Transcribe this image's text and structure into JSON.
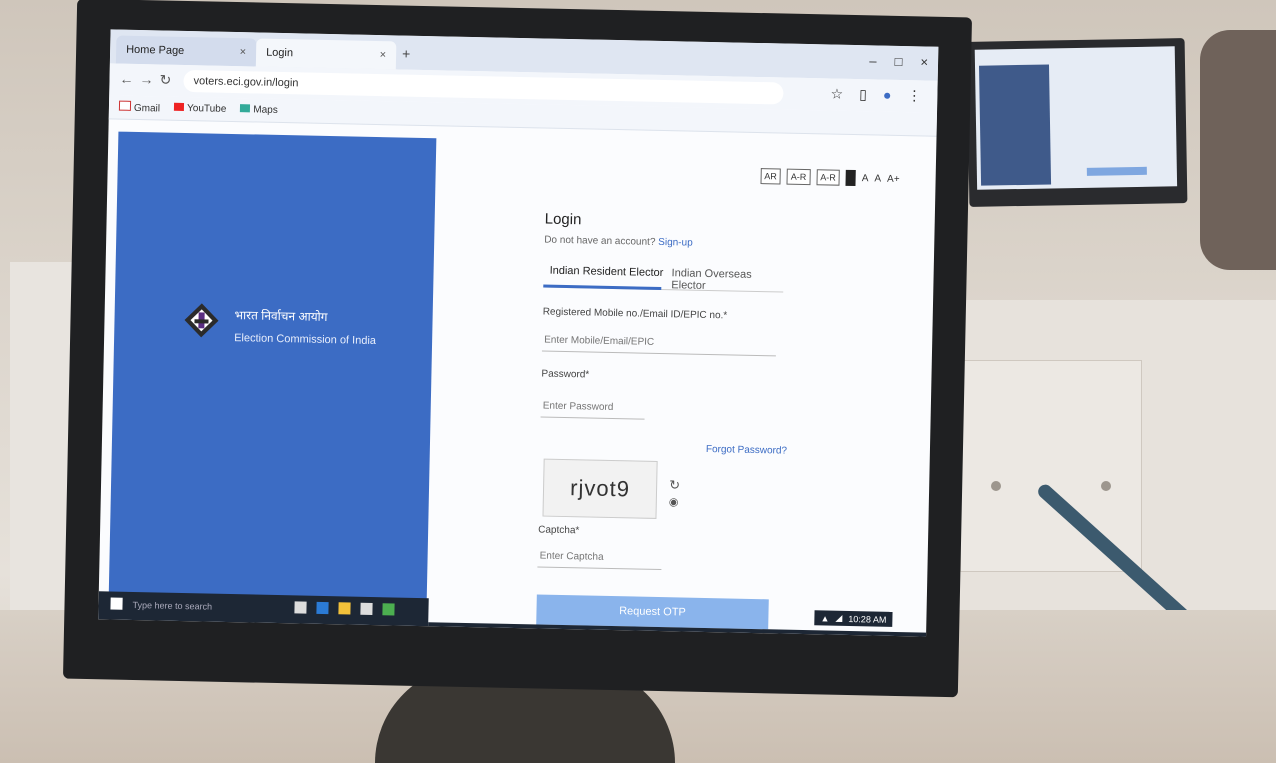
{
  "browser": {
    "tabs": [
      {
        "label": "Home Page",
        "close": "×"
      },
      {
        "label": "Login",
        "close": "×"
      }
    ],
    "new_tab": "+",
    "window_controls": [
      "–",
      "□",
      "×"
    ],
    "address": "voters.eci.gov.in/login",
    "bookmarks": [
      "Gmail",
      "YouTube",
      "Maps"
    ]
  },
  "brand": {
    "hindi": "भारत निर्वाचन आयोग",
    "english": "Election Commission of India"
  },
  "accessibility": [
    "AR",
    "A-R",
    "A-R",
    "A",
    "A",
    "A+"
  ],
  "login": {
    "title": "Login",
    "register_prefix": "Do not have an account?",
    "register_link": "Sign-up",
    "tabs": [
      "Indian Resident Elector",
      "Indian Overseas Elector"
    ],
    "id_label": "Registered Mobile no./Email ID/EPIC no.*",
    "id_placeholder": "Enter Mobile/Email/EPIC",
    "password_label": "Password*",
    "password_placeholder": "Enter Password",
    "forgot_password": "Forgot Password?",
    "captcha_text": "rjvot9",
    "captcha_label": "Captcha*",
    "captcha_placeholder": "Enter Captcha",
    "submit_button": "Request OTP"
  },
  "taskbar": {
    "search_hint": "Type here to search",
    "clock": "10:28 AM"
  },
  "colors": {
    "brand_blue": "#3c6cc4",
    "button_blue": "#8ab4ec"
  }
}
